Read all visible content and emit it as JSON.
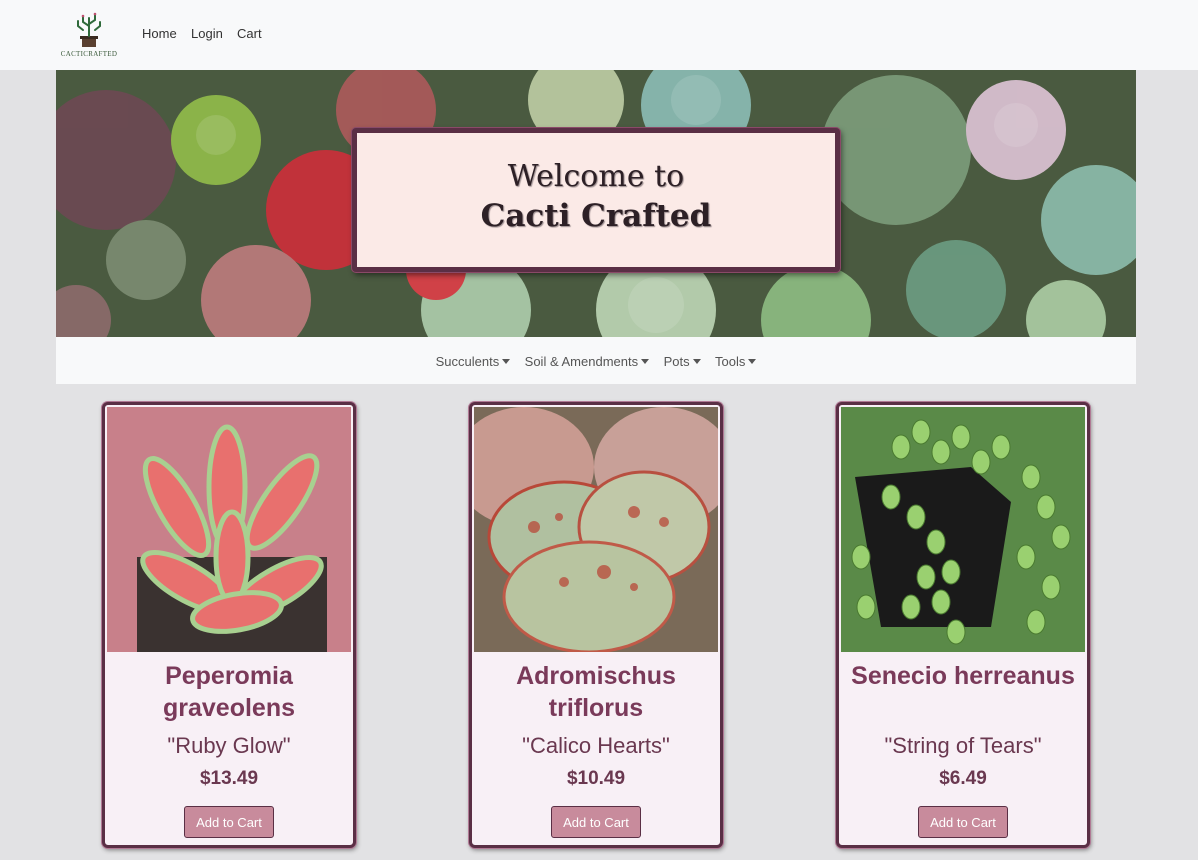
{
  "brand": {
    "logo_text": "CACTICRAFTED"
  },
  "topnav": {
    "home": "Home",
    "login": "Login",
    "cart": "Cart"
  },
  "hero": {
    "line1": "Welcome to",
    "line2": "Cacti Crafted"
  },
  "categories": [
    {
      "label": "Succulents"
    },
    {
      "label": "Soil & Amendments"
    },
    {
      "label": "Pots"
    },
    {
      "label": "Tools"
    }
  ],
  "products": [
    {
      "name": "Peperomia graveolens",
      "cultivar": "\"Ruby Glow\"",
      "price": "$13.49",
      "button": "Add to Cart"
    },
    {
      "name": "Adromischus triflorus",
      "cultivar": "\"Calico Hearts\"",
      "price": "$10.49",
      "button": "Add to Cart"
    },
    {
      "name": "Senecio herreanus",
      "cultivar": "\"String of Tears\"",
      "price": "$6.49",
      "button": "Add to Cart"
    }
  ],
  "colors": {
    "accent": "#7a3a5a",
    "border": "#5a2f45",
    "button": "#c88b9c",
    "card_bg": "#f8f0f6",
    "welcome_bg": "#fbeae7"
  }
}
